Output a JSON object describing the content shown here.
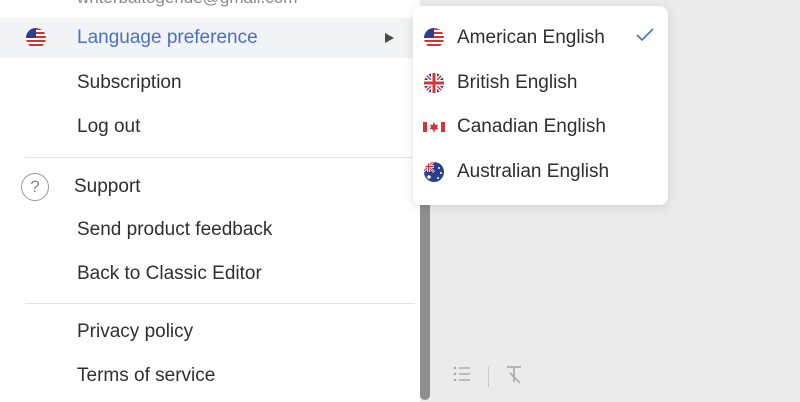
{
  "account": {
    "email": "writerbaltogeride@gmail.com"
  },
  "menu": {
    "language_preference": "Language preference",
    "subscription": "Subscription",
    "log_out": "Log out",
    "support": "Support",
    "send_feedback": "Send product feedback",
    "back_to_classic": "Back to Classic Editor",
    "privacy_policy": "Privacy policy",
    "terms_of_service": "Terms of service"
  },
  "submenu": {
    "options": [
      {
        "label": "American English",
        "flag": "us-flag-icon",
        "selected": true
      },
      {
        "label": "British English",
        "flag": "uk-flag-icon",
        "selected": false
      },
      {
        "label": "Canadian English",
        "flag": "canada-flag-icon",
        "selected": false
      },
      {
        "label": "Australian English",
        "flag": "australia-flag-icon",
        "selected": false
      }
    ]
  },
  "icons": {
    "help": "?",
    "accent_color": "#4a6fc9",
    "checkmark_color": "#4a6fc9"
  }
}
